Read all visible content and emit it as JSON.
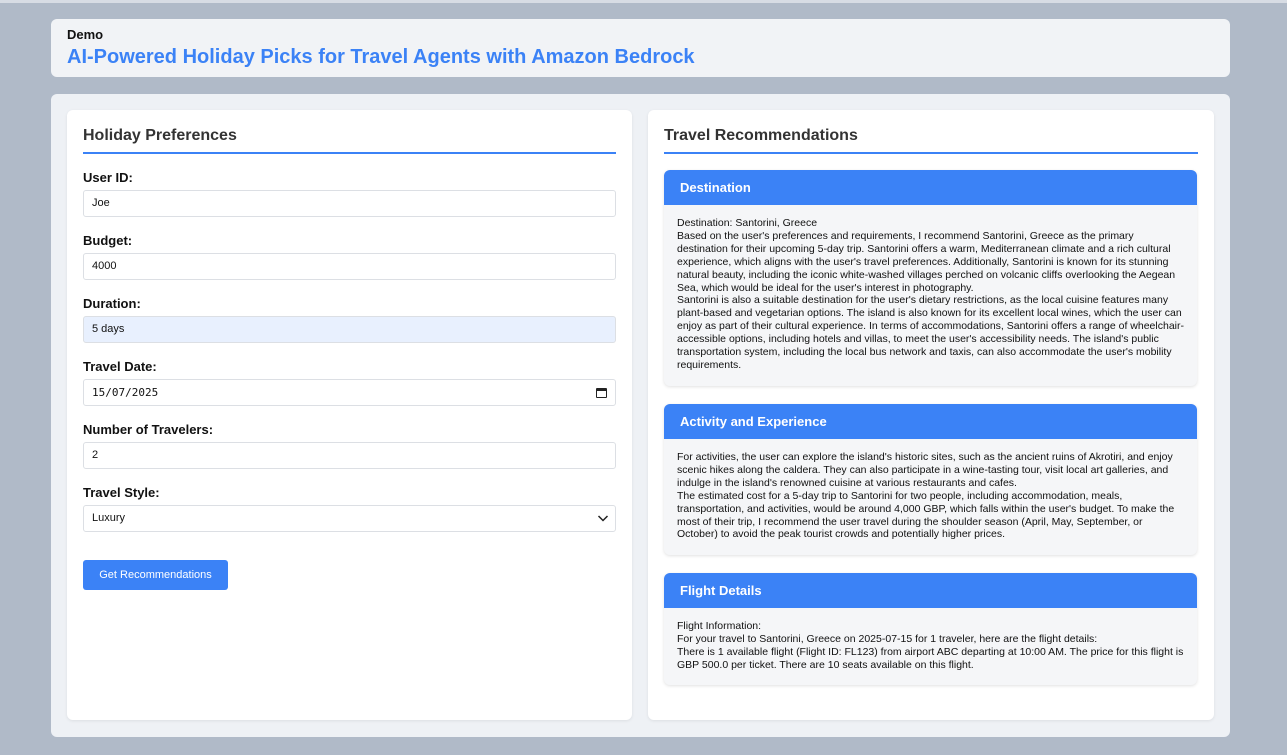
{
  "header": {
    "demo_label": "Demo",
    "title": "AI-Powered Holiday Picks for Travel Agents with Amazon Bedrock"
  },
  "preferences": {
    "title": "Holiday Preferences",
    "fields": {
      "user_id": {
        "label": "User ID:",
        "value": "Joe"
      },
      "budget": {
        "label": "Budget:",
        "value": "4000"
      },
      "duration": {
        "label": "Duration:",
        "value": "5 days"
      },
      "travel_date": {
        "label": "Travel Date:",
        "value": "15/07/2025"
      },
      "travelers": {
        "label": "Number of Travelers:",
        "value": "2"
      },
      "travel_style": {
        "label": "Travel Style:",
        "value": "Luxury"
      }
    },
    "submit_label": "Get Recommendations"
  },
  "recommendations": {
    "title": "Travel Recommendations",
    "destination": {
      "heading": "Destination",
      "paragraphs": [
        "Destination: Santorini, Greece",
        "Based on the user's preferences and requirements, I recommend Santorini, Greece as the primary destination for their upcoming 5-day trip. Santorini offers a warm, Mediterranean climate and a rich cultural experience, which aligns with the user's travel preferences. Additionally, Santorini is known for its stunning natural beauty, including the iconic white-washed villages perched on volcanic cliffs overlooking the Aegean Sea, which would be ideal for the user's interest in photography.",
        "Santorini is also a suitable destination for the user's dietary restrictions, as the local cuisine features many plant-based and vegetarian options. The island is also known for its excellent local wines, which the user can enjoy as part of their cultural experience. In terms of accommodations, Santorini offers a range of wheelchair-accessible options, including hotels and villas, to meet the user's accessibility needs. The island's public transportation system, including the local bus network and taxis, can also accommodate the user's mobility requirements."
      ]
    },
    "activity": {
      "heading": "Activity and Experience",
      "paragraphs": [
        "For activities, the user can explore the island's historic sites, such as the ancient ruins of Akrotiri, and enjoy scenic hikes along the caldera. They can also participate in a wine-tasting tour, visit local art galleries, and indulge in the island's renowned cuisine at various restaurants and cafes.",
        "The estimated cost for a 5-day trip to Santorini for two people, including accommodation, meals, transportation, and activities, would be around 4,000 GBP, which falls within the user's budget. To make the most of their trip, I recommend the user travel during the shoulder season (April, May, September, or October) to avoid the peak tourist crowds and potentially higher prices."
      ]
    },
    "flight": {
      "heading": "Flight Details",
      "paragraphs": [
        "Flight Information:",
        "For your travel to Santorini, Greece on 2025-07-15 for 1 traveler, here are the flight details:",
        "There is 1 available flight (Flight ID: FL123) from airport ABC departing at 10:00 AM. The price for this flight is GBP 500.0 per ticket. There are 10 seats available on this flight."
      ]
    }
  },
  "colors": {
    "accent": "#3b82f6",
    "background": "#b0bac8"
  }
}
